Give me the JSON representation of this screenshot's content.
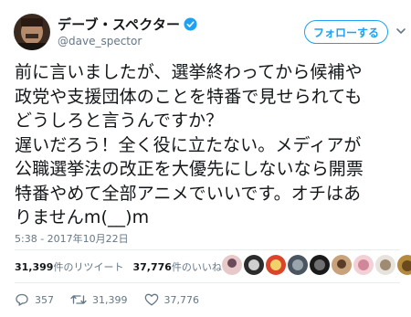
{
  "author": {
    "display_name": "デーブ・スペクター",
    "handle": "@dave_spector",
    "avatar_icon": "avatar",
    "verified_icon": "verified-badge-icon"
  },
  "follow_button_label": "フォローする",
  "tweet": {
    "text": "前に言いましたが、選挙終わってから候補や\n政党や支援団体のことを特番で見せられても\nどうしろと言うんですか？\n 遅いだろう！全く役に立たない。メディアが\n公職選挙法の改正を大優先にしないなら開票\n特番やめて全部アニメでいいです。オチはあ\nりませんm(__)m",
    "timestamp": "5:38 - 2017年10月22日"
  },
  "stats": {
    "retweets_count": "31,399",
    "retweets_label": "件のリツイート",
    "likes_count": "37,776",
    "likes_label": "件のいいね"
  },
  "actions": {
    "reply_count": "357",
    "retweet_count": "31,399",
    "like_count": "37,776"
  },
  "colors": {
    "accent": "#1da1f2",
    "secondary_text": "#657786",
    "divider": "#e6ecf0"
  }
}
